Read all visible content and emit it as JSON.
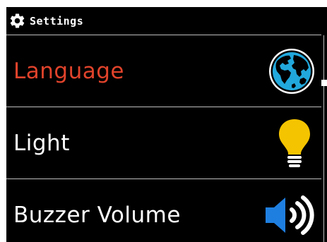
{
  "header": {
    "title": "Settings",
    "icon": "gear-icon"
  },
  "menu": {
    "items": [
      {
        "label": "Language",
        "icon": "globe-icon",
        "active": true
      },
      {
        "label": "Light",
        "icon": "lightbulb-icon",
        "active": false
      },
      {
        "label": "Buzzer Volume",
        "icon": "speaker-volume-icon",
        "active": false
      }
    ]
  },
  "colors": {
    "background": "#000000",
    "active_text": "#e0432b",
    "text": "#ffffff",
    "divider": "#bfbfbf",
    "globe_ocean": "#21a8dc",
    "bulb": "#f5c400",
    "speaker": "#1f7fe0"
  }
}
